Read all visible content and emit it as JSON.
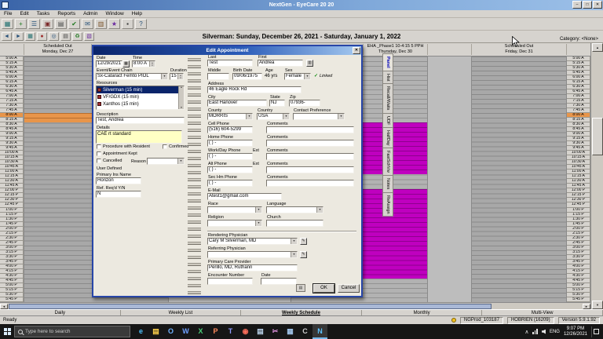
{
  "window": {
    "title": "NextGen - EyeCare 20 20"
  },
  "menu": {
    "items": [
      "File",
      "Edit",
      "Tasks",
      "Reports",
      "Admin",
      "Window",
      "Help"
    ]
  },
  "toolbar_main": {
    "icons": [
      {
        "name": "appointment-book-icon",
        "glyph": "▦",
        "color": "#1c6e6e"
      },
      {
        "name": "new-appointment-icon",
        "glyph": "+",
        "color": "#1f7a1f"
      },
      {
        "name": "find-patient-icon",
        "glyph": "☰",
        "color": "#28527a"
      },
      {
        "name": "patient-info-icon",
        "glyph": "▣",
        "color": "#7a2828"
      },
      {
        "name": "print-icon",
        "glyph": "▤",
        "color": "#444444"
      },
      {
        "name": "tasks-icon",
        "glyph": "✔",
        "color": "#1f7a1f"
      },
      {
        "name": "mail-icon",
        "glyph": "✉",
        "color": "#28527a"
      },
      {
        "name": "reports-icon",
        "glyph": "▥",
        "color": "#7a5228"
      },
      {
        "name": "admin-icon",
        "glyph": "★",
        "color": "#6a28a0"
      },
      {
        "name": "lock-icon",
        "glyph": "▪",
        "color": "#333333"
      },
      {
        "name": "help-icon",
        "glyph": "?",
        "color": "#28527a"
      }
    ]
  },
  "toolbar_schedule": {
    "icons": [
      {
        "name": "previous-week-icon",
        "glyph": "◄",
        "color": "#28527a"
      },
      {
        "name": "next-week-icon",
        "glyph": "►",
        "color": "#28527a"
      },
      {
        "name": "calendar-icon",
        "glyph": "▦",
        "color": "#1c6e6e"
      },
      {
        "name": "today-icon",
        "glyph": "●",
        "color": "#a03030"
      },
      {
        "name": "find-slot-icon",
        "glyph": "◎",
        "color": "#28527a"
      },
      {
        "name": "print-schedule-icon",
        "glyph": "▤",
        "color": "#444444"
      },
      {
        "name": "refresh-icon",
        "glyph": "♻",
        "color": "#1f7a1f"
      },
      {
        "name": "legend-icon",
        "glyph": "▧",
        "color": "#6a28a0"
      }
    ]
  },
  "schedule_header": {
    "title": "Silverman: Sunday, December 26, 2021 - Saturday, January 1, 2022",
    "category_label": "Category: <None>"
  },
  "schedule": {
    "times": [
      "5:00 A",
      "5:15 A",
      "5:30 A",
      "5:45 A",
      "6:00 A",
      "6:15 A",
      "6:30 A",
      "6:45 A",
      "7:00 A",
      "7:15 A",
      "7:30 A",
      "7:45 A",
      "8:00 A",
      "8:15 A",
      "8:30 A",
      "8:45 A",
      "9:00 A",
      "9:15 A",
      "9:30 A",
      "9:45 A",
      "10:00 A",
      "10:15 A",
      "10:30 A",
      "10:45 A",
      "11:00 A",
      "11:15 A",
      "11:30 A",
      "11:45 A",
      "12:00 P",
      "12:15 P",
      "12:30 P",
      "12:45 P",
      "1:00 P",
      "1:15 P",
      "1:30 P",
      "1:45 P",
      "2:00 P",
      "2:15 P",
      "2:30 P",
      "2:45 P",
      "3:00 P",
      "3:15 P",
      "3:30 P",
      "3:45 P",
      "4:00 P",
      "4:15 P",
      "4:30 P",
      "4:45 P",
      "5:00 P",
      "5:15 P",
      "5:30 P",
      "5:45 P"
    ],
    "highlight_time_index": 12,
    "columns": [
      {
        "name": "Scheduled Out",
        "date": "Monday, Dec 27"
      },
      {
        "name": "EHA _Phase1 10-4:15 5 PPH",
        "date": "Thursday, Dec 30",
        "blocks": [
          {
            "start": 14,
            "end": 24
          },
          {
            "start": 28,
            "end": 46
          }
        ]
      },
      {
        "name": "Scheduled Out",
        "date": "Friday, Dec 31"
      }
    ],
    "appointment_block": {
      "start": 12,
      "end": 13
    }
  },
  "side_tabs": [
    "Panel",
    "Hist",
    "Recall/Waits",
    "UDF",
    "HalfDay",
    "FastSchVw",
    "Notes",
    "ReAssign"
  ],
  "dialog": {
    "title": "Edit Appointment",
    "date_label": "Date",
    "date_value": "12/29/2021",
    "time_label": "Time",
    "time_value": "8:00 A",
    "event_label": "Event/Event Chain",
    "event_value": "Sx-Cataract Femto PIOL",
    "duration_label": "Duration",
    "duration_value": "15",
    "resources_label": "Resources",
    "resources": [
      "Silverman (15 min)",
      "VF/GDX (15 min)",
      "Xanthos (15 min)"
    ],
    "description_label": "Description",
    "description_value": "Test, Andrea",
    "details_label": "Details",
    "details_value": "CAE rt standard",
    "checkboxes": {
      "procedure": "Procedure with Resident",
      "confirmed": "Confirmed",
      "kept": "Appointment Kept",
      "cancelled": "Cancelled",
      "reason_label": "Reason"
    },
    "user_defined_label": "User Defined",
    "primary_ins_label": "Primary Ins Name",
    "primary_ins_value": "Horizon",
    "ref_req_label": "Ref. Req'd Y/N",
    "ref_req_value": "N",
    "ok_label": "OK",
    "cancel_label": "Cancel",
    "patient": {
      "last_label": "Last",
      "last": "Test",
      "first_label": "First",
      "first": "Andrea",
      "middle_label": "Middle",
      "middle": "",
      "birth_label": "Birth Date",
      "birth": "09/06/1975",
      "age_label": "Age",
      "age": "46 yrs",
      "sex_label": "Sex",
      "sex": "Female",
      "linked_label": "Linked",
      "address_label": "Address",
      "address": "46 Eagle Rock Rd",
      "city_label": "City",
      "city": "East Hanover",
      "state_label": "State",
      "state": "NJ",
      "zip_label": "Zip",
      "zip": "07936-",
      "county_label": "County",
      "county": "MORRIS",
      "country_label": "Country",
      "country": "USA",
      "contact_pref_label": "Contact Preference",
      "contact_pref": "",
      "phones": [
        {
          "label": "Cell Phone",
          "value": "(516) 604-5299",
          "comments_label": "Comments",
          "comments": ""
        },
        {
          "label": "Home Phone",
          "value": "(   )    -",
          "comments_label": "Comments",
          "comments": ""
        },
        {
          "label": "Work/Day Phone",
          "ext_label": "Ext",
          "value": "(   )    -",
          "comments_label": "Comments",
          "comments": ""
        },
        {
          "label": "Alt Phone",
          "ext_label": "Ext",
          "value": "(   )    -",
          "comments_label": "Comments",
          "comments": ""
        },
        {
          "label": "Sec Hm Phone",
          "value": "(   )    -",
          "comments_label": "Comments",
          "comments": ""
        }
      ],
      "email_label": "E-Mail",
      "email": "Atest1@gmail.com",
      "race_label": "Race",
      "race": "",
      "language_label": "Language",
      "language": "",
      "religion_label": "Religion",
      "religion": "",
      "church_label": "Church",
      "church": "",
      "rendering_label": "Rendering Physician",
      "rendering": "Cary M Silverman, MD",
      "referring_label": "Referring Physician",
      "referring": "",
      "pcp_label": "Primary Care Provider",
      "pcp": "Perillo, MD, Ruthann",
      "encounter_label": "Encounter Number",
      "encounter": "",
      "enc_date_label": "Date",
      "enc_date": ""
    }
  },
  "view_tabs": {
    "items": [
      "Daily",
      "Weekly List",
      "Weekly Schedule",
      "Monthly",
      "Multi-View"
    ],
    "active": "Weekly Schedule"
  },
  "status_bar": {
    "ready": "Ready",
    "database": "NGProd_103187",
    "user": "HOBRIEN (16209)",
    "version": "Version 5.9.1.92"
  },
  "taskbar": {
    "search_placeholder": "Type here to search",
    "icons": [
      {
        "name": "edge-icon",
        "glyph": "e",
        "color": "#4cc2ff"
      },
      {
        "name": "file-explorer-icon",
        "glyph": "▤",
        "color": "#ffd24c"
      },
      {
        "name": "outlook-icon",
        "glyph": "O",
        "color": "#6fb2ff"
      },
      {
        "name": "word-icon",
        "glyph": "W",
        "color": "#6fa0ff"
      },
      {
        "name": "excel-icon",
        "glyph": "X",
        "color": "#4ccf7a"
      },
      {
        "name": "powerpoint-icon",
        "glyph": "P",
        "color": "#ff8a5c"
      },
      {
        "name": "teams-icon",
        "glyph": "T",
        "color": "#8f9bff"
      },
      {
        "name": "chrome-icon",
        "glyph": "◉",
        "color": "#ff6f5c"
      },
      {
        "name": "notepad-icon",
        "glyph": "▤",
        "color": "#bcd4ec"
      },
      {
        "name": "snipping-tool-icon",
        "glyph": "✂",
        "color": "#d98fd9"
      },
      {
        "name": "calculator-icon",
        "glyph": "▦",
        "color": "#9fc2e8"
      },
      {
        "name": "citrix-icon",
        "glyph": "C",
        "color": "#cccccc"
      },
      {
        "name": "nextgen-icon",
        "glyph": "N",
        "color": "#5cc2ff",
        "active": true
      }
    ],
    "lang": "ENG",
    "time": "9:07 PM",
    "date": "12/26/2021"
  }
}
